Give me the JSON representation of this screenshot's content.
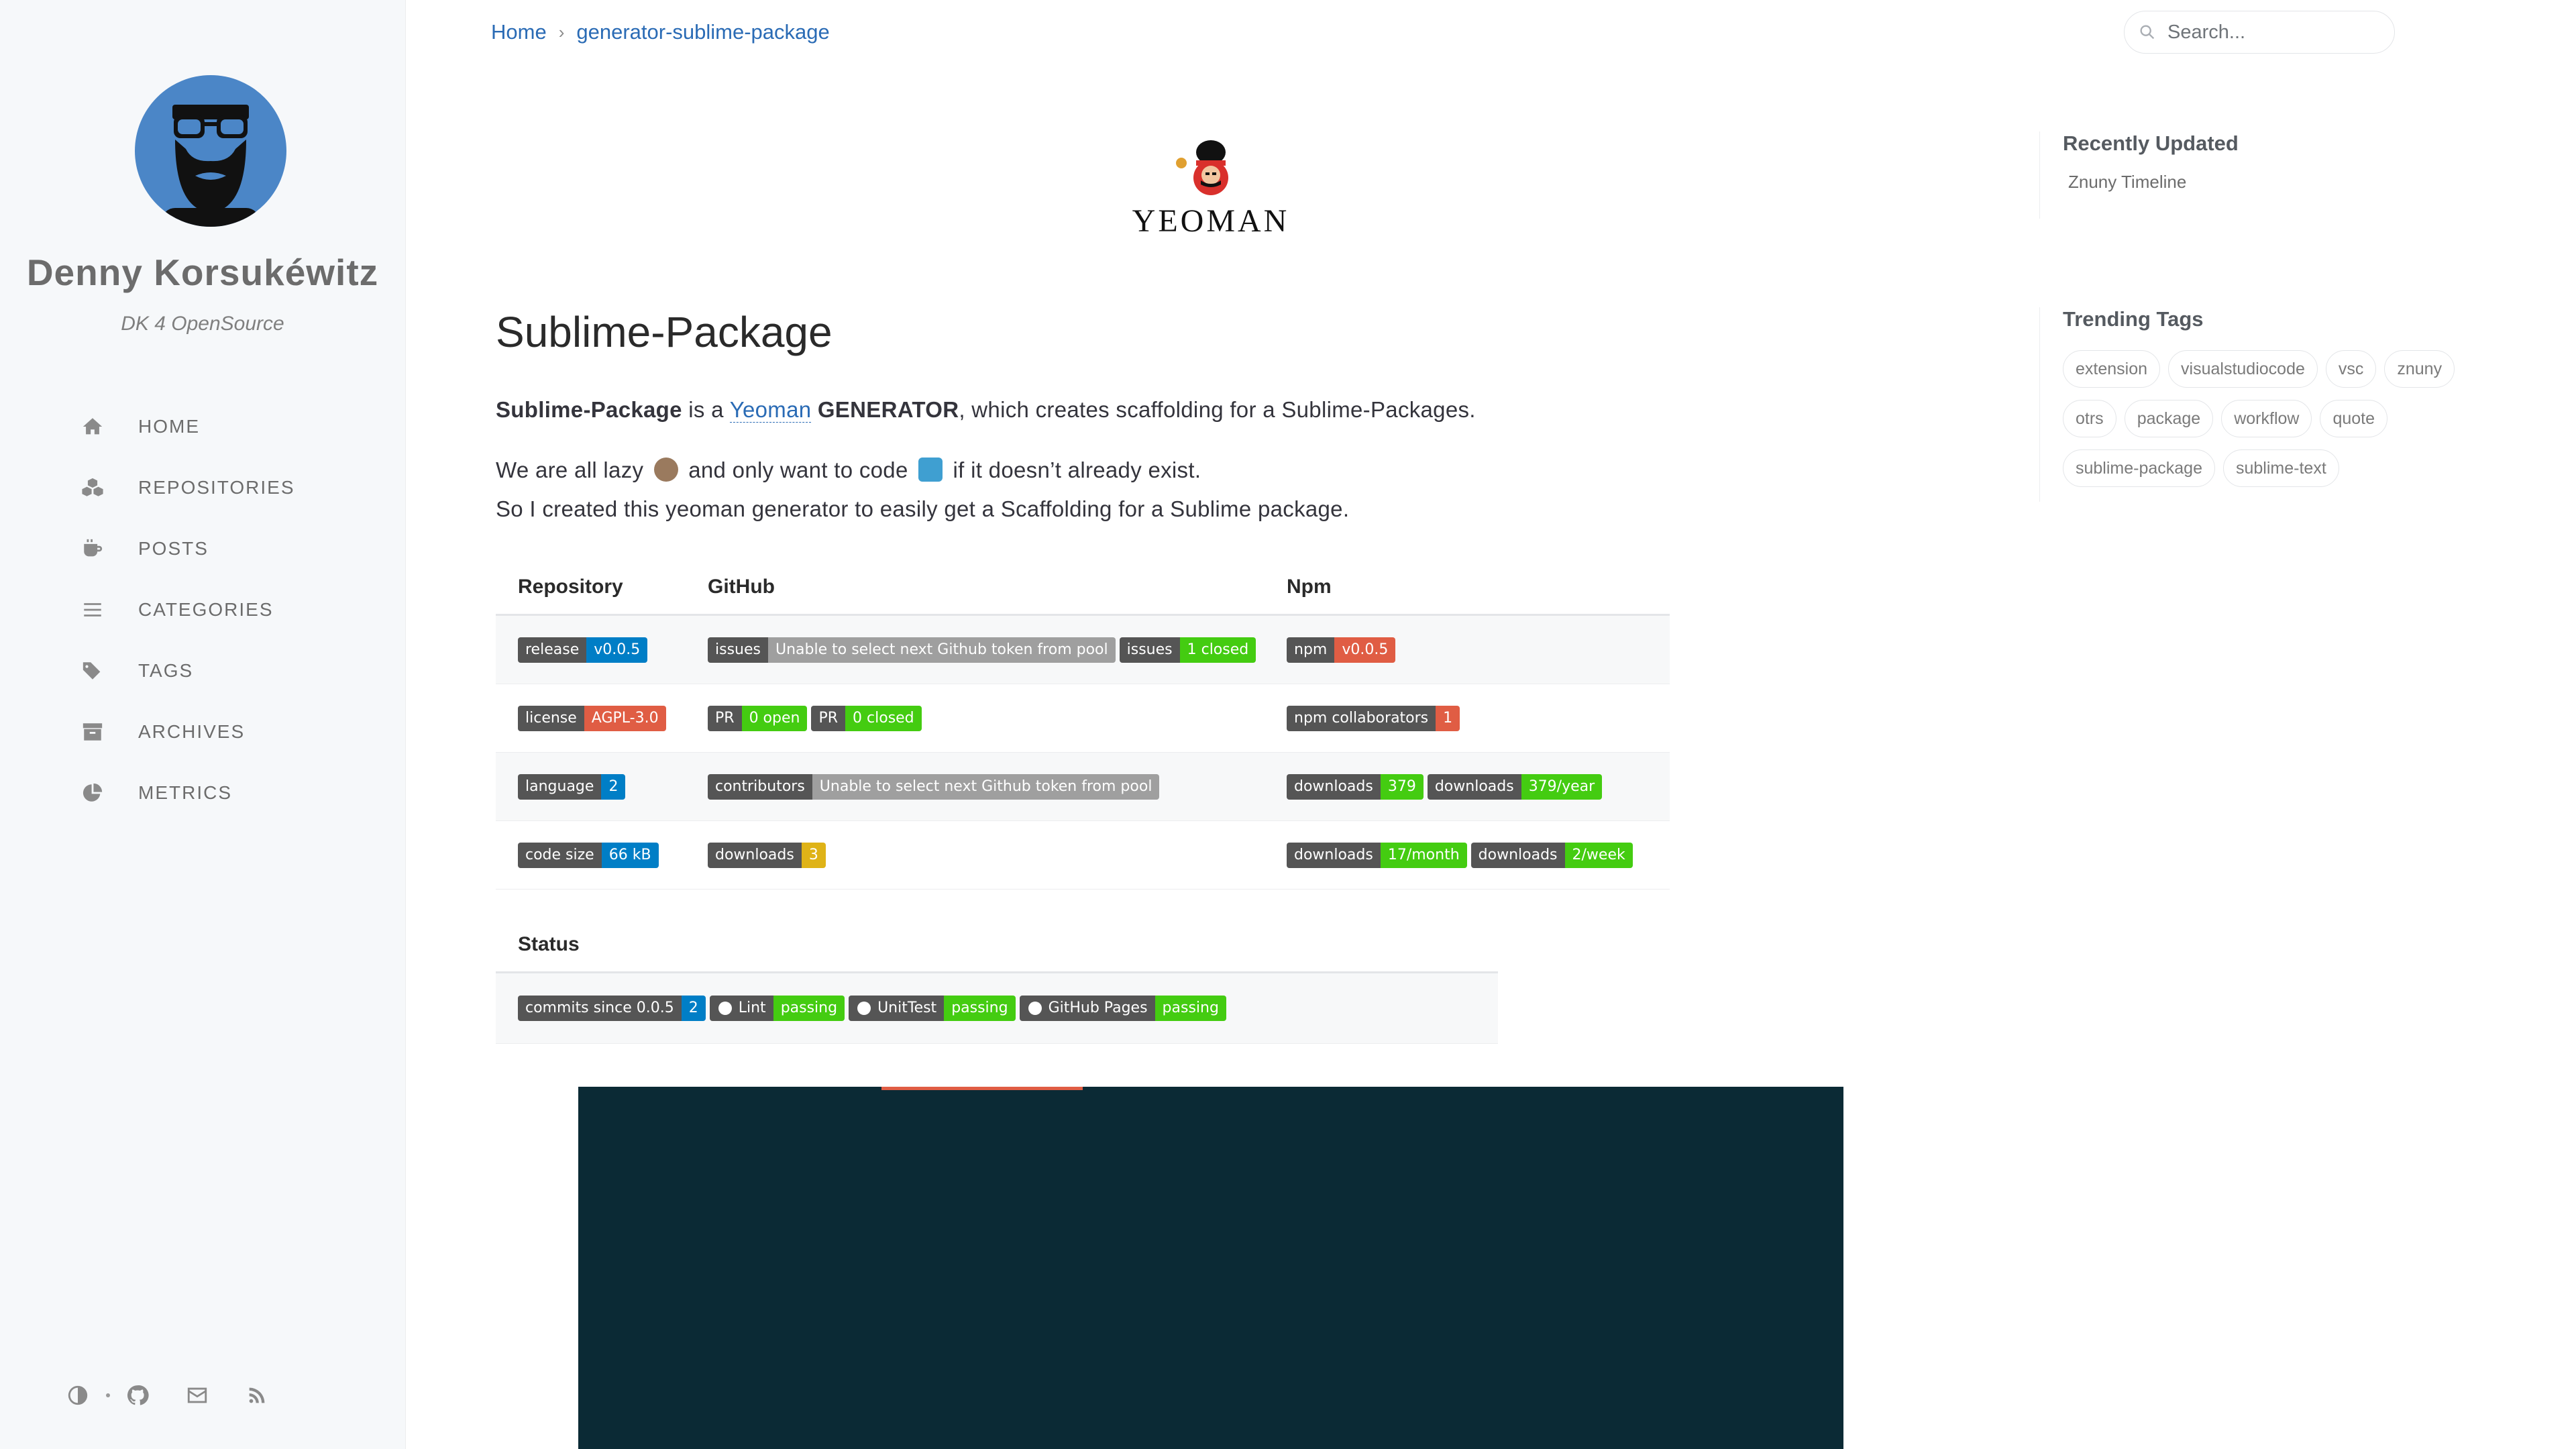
{
  "sidebar": {
    "title": "Denny Korsukéwitz",
    "subtitle": "DK 4 OpenSource",
    "nav": [
      {
        "label": "HOME",
        "icon": "home-icon"
      },
      {
        "label": "REPOSITORIES",
        "icon": "cubes-icon"
      },
      {
        "label": "POSTS",
        "icon": "coffee-icon"
      },
      {
        "label": "CATEGORIES",
        "icon": "bars-icon"
      },
      {
        "label": "TAGS",
        "icon": "tags-icon"
      },
      {
        "label": "ARCHIVES",
        "icon": "archive-icon"
      },
      {
        "label": "METRICS",
        "icon": "chart-pie-icon"
      }
    ],
    "bottom_icons": [
      "theme-toggle-icon",
      "github-icon",
      "email-icon",
      "rss-icon"
    ]
  },
  "breadcrumb": {
    "home": "Home",
    "current": "generator-sublime-package"
  },
  "search": {
    "placeholder": "Search..."
  },
  "post": {
    "logo_text": "YEOMAN",
    "title": "Sublime-Package",
    "intro_bold": "Sublime-Package",
    "intro_is": " is a ",
    "intro_link": "Yeoman",
    "intro_gen": "GENERATOR",
    "intro_rest": ", which creates scaffolding for a Sublime-Packages.",
    "lazy_1": "We are all lazy ",
    "lazy_2": " and only want to code ",
    "lazy_3": " if it doesn’t already exist.",
    "line_3": "So I created this yeoman generator to easily get a Scaffolding for a Sublime package."
  },
  "repo_table": {
    "headers": [
      "Repository",
      "GitHub",
      "Npm"
    ],
    "badges": {
      "release": [
        "release",
        "v0.0.5"
      ],
      "license": [
        "license",
        "AGPL-3.0"
      ],
      "language": [
        "language",
        "2"
      ],
      "code_size": [
        "code size",
        "66 kB"
      ],
      "issues_open": [
        "issues",
        "Unable to select next Github token from pool"
      ],
      "issues_closed": [
        "issues",
        "1 closed"
      ],
      "pr_open": [
        "PR",
        "0 open"
      ],
      "pr_closed": [
        "PR",
        "0 closed"
      ],
      "contributors": [
        "contributors",
        "Unable to select next Github token from pool"
      ],
      "gh_downloads": [
        "downloads",
        "3"
      ],
      "npm": [
        "npm",
        "v0.0.5"
      ],
      "npm_collab": [
        "npm collaborators",
        "1"
      ],
      "dl_total": [
        "downloads",
        "379"
      ],
      "dl_year": [
        "downloads",
        "379/year"
      ],
      "dl_month": [
        "downloads",
        "17/month"
      ],
      "dl_week": [
        "downloads",
        "2/week"
      ]
    }
  },
  "status_table": {
    "header": "Status",
    "badges": {
      "commits": [
        "commits since 0.0.5",
        "2"
      ],
      "lint": [
        "Lint",
        "passing"
      ],
      "unittest": [
        "UnitTest",
        "passing"
      ],
      "pages": [
        "GitHub Pages",
        "passing"
      ]
    }
  },
  "recently_updated": {
    "title": "Recently Updated",
    "items": [
      "Znuny Timeline"
    ]
  },
  "trending_tags": {
    "title": "Trending Tags",
    "tags": [
      "extension",
      "visualstudiocode",
      "vsc",
      "znuny",
      "otrs",
      "package",
      "workflow",
      "quote",
      "sublime-package",
      "sublime-text"
    ]
  },
  "colors": {
    "accent": "#2a6bb5",
    "avatar_bg": "#4b86c7",
    "terminal_bg": "#0b2a35"
  }
}
